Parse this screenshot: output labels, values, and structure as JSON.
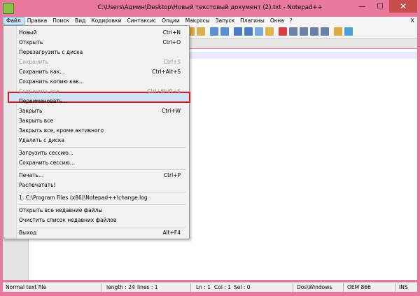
{
  "window": {
    "title": "C:\\Users\\Админ\\Desktop\\Новый текстовый документ (2).txt - Notepad++",
    "minimize": "—",
    "maximize": "☐",
    "close": "✕"
  },
  "menubar": {
    "items": [
      "Файл",
      "Правка",
      "Поиск",
      "Вид",
      "Кодировки",
      "Синтаксис",
      "Опции",
      "Макросы",
      "Запуск",
      "Плагины",
      "Окна",
      "?"
    ],
    "close": "X",
    "active_index": 0
  },
  "file_menu": {
    "items": [
      {
        "label": "Новый",
        "shortcut": "Ctrl+N",
        "disabled": false
      },
      {
        "label": "Открыть",
        "shortcut": "Ctrl+O",
        "disabled": false
      },
      {
        "label": "Перезагрузить с диска",
        "shortcut": "",
        "disabled": false
      },
      {
        "label": "Сохранить",
        "shortcut": "Ctrl+S",
        "disabled": true
      },
      {
        "label": "Сохранить как...",
        "shortcut": "Ctrl+Alt+S",
        "disabled": false,
        "highlighted": true
      },
      {
        "label": "Сохранить копию как...",
        "shortcut": "",
        "disabled": false
      },
      {
        "label": "Сохранить все",
        "shortcut": "Ctrl+Shift+S",
        "disabled": true
      },
      {
        "label": "Переименовать...",
        "shortcut": "",
        "disabled": false
      },
      {
        "label": "Закрыть",
        "shortcut": "Ctrl+W",
        "disabled": false
      },
      {
        "label": "Закрыть все",
        "shortcut": "",
        "disabled": false
      },
      {
        "label": "Закрыть все, кроме активного",
        "shortcut": "",
        "disabled": false
      },
      {
        "label": "Удалить с диска",
        "shortcut": "",
        "disabled": false
      },
      {
        "label": "Загрузить сессию...",
        "shortcut": "",
        "disabled": false
      },
      {
        "label": "Сохранить сессию...",
        "shortcut": "",
        "disabled": false
      },
      {
        "label": "Печать...",
        "shortcut": "Ctrl+P",
        "disabled": false
      },
      {
        "label": "Распечатать!",
        "shortcut": "",
        "disabled": false
      },
      {
        "label": "1: C:\\Program Files (x86)\\Notepad++\\change.log",
        "shortcut": "",
        "disabled": false
      },
      {
        "label": "Открыть все недавние файлы",
        "shortcut": "",
        "disabled": false
      },
      {
        "label": "Очистить список недавних файлов",
        "shortcut": "",
        "disabled": false
      },
      {
        "label": "Выход",
        "shortcut": "Alt+F4",
        "disabled": false
      }
    ]
  },
  "statusbar": {
    "file_type": "Normal text file",
    "length": "length : 24",
    "lines": "lines : 1",
    "ln": "Ln : 1",
    "col": "Col : 1",
    "sel": "Sel : 0",
    "eol": "Dos\\Windows",
    "encoding": "OEM 866",
    "mode": "INS"
  },
  "colors": {
    "frame": "#e8799b",
    "highlight_border": "#e0161d",
    "close_button": "#c74c4c"
  }
}
